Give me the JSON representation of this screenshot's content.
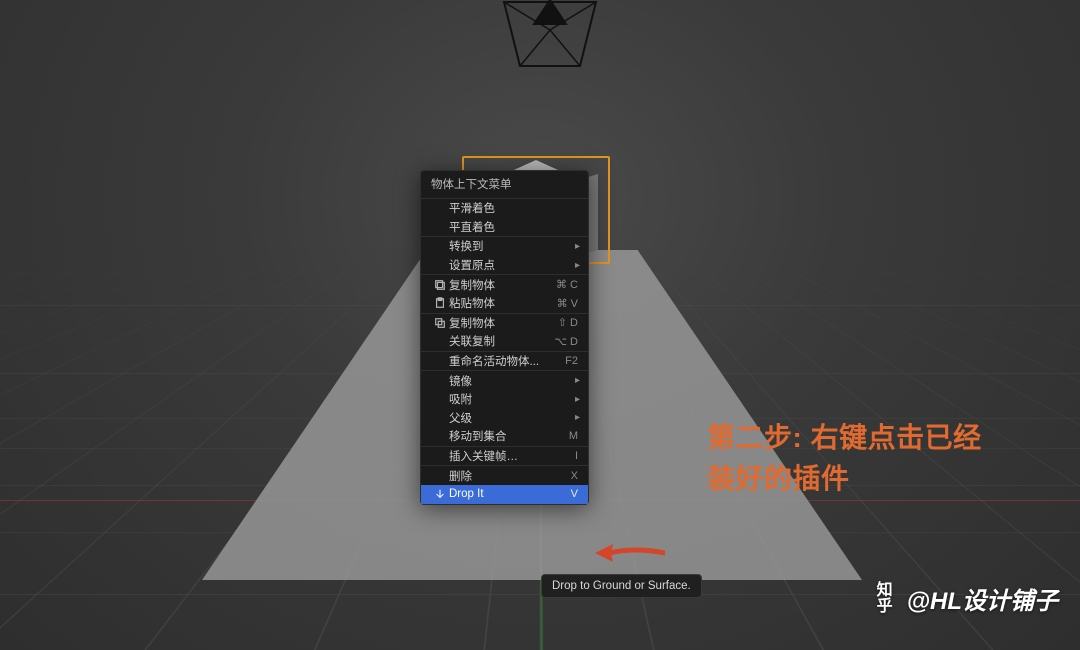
{
  "menu": {
    "title": "物体上下文菜单",
    "items": [
      {
        "label": "平滑着色"
      },
      {
        "label": "平直着色"
      }
    ],
    "items2": [
      {
        "label": "转换到",
        "submenu": true
      },
      {
        "label": "设置原点",
        "submenu": true
      }
    ],
    "items3": [
      {
        "label": "复制物体",
        "icon": "copy",
        "shortcut": "⌘ C"
      },
      {
        "label": "粘贴物体",
        "icon": "paste",
        "shortcut": "⌘ V"
      }
    ],
    "items4": [
      {
        "label": "复制物体",
        "icon": "dup",
        "shortcut": "⇧ D"
      },
      {
        "label": "关联复制",
        "shortcut": "⌥ D"
      }
    ],
    "items5": [
      {
        "label": "重命名活动物体...",
        "shortcut": "F2"
      }
    ],
    "items6": [
      {
        "label": "镜像",
        "submenu": true
      },
      {
        "label": "吸附",
        "submenu": true
      },
      {
        "label": "父级",
        "submenu": true
      },
      {
        "label": "移动到集合",
        "shortcut": "M"
      }
    ],
    "items7": [
      {
        "label": "插入关键帧…",
        "shortcut": "I"
      }
    ],
    "items8": [
      {
        "label": "删除",
        "shortcut": "X"
      },
      {
        "label": "Drop It",
        "icon": "drop",
        "shortcut": "V",
        "highlight": true
      }
    ]
  },
  "tooltip": "Drop to Ground or Surface.",
  "annotation": {
    "line1": "第二步: 右键点击已经",
    "line2": "装好的插件"
  },
  "watermark": {
    "logo1": "知",
    "logo2": "乎",
    "text": "@HL设计铺子"
  }
}
